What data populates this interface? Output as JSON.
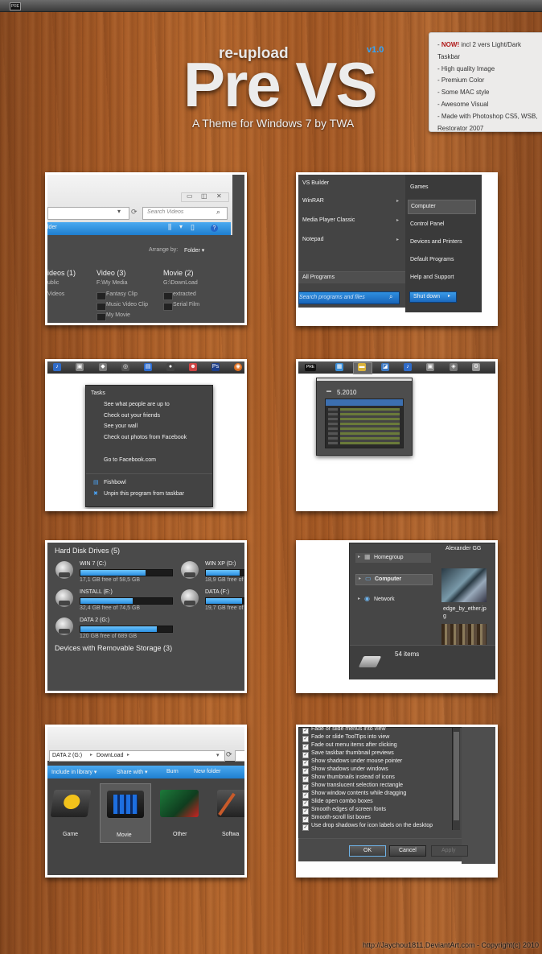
{
  "top": {
    "logo": "PRE"
  },
  "hero": {
    "reupload": "re-upload",
    "title": "Pre VS",
    "version": "v1.0",
    "subtitle": "A Theme for Windows 7 by TWA"
  },
  "features": {
    "new_label": "NOW!",
    "new_rest": " incl 2 vers Light/Dark Taskbar",
    "items": [
      "- High quality Image",
      "- Premium Color",
      "- Some MAC style",
      "- Awesome Visual",
      "- Made with Photoshop CS5, WSB,",
      "  Restorator 2007"
    ]
  },
  "p1": {
    "search_placeholder": "Search Videos",
    "toolbar_left": "lder",
    "arrange_label": "Arrange by:",
    "arrange_value": "Folder",
    "groups": [
      {
        "title": "ideos (1)",
        "sub": "ublic",
        "items": [
          "Videos"
        ]
      },
      {
        "title": "Video (3)",
        "sub": "F:\\My Media",
        "items": [
          "Fantasy Clip",
          "Music Video Clip",
          "My Movie"
        ]
      },
      {
        "title": "Movie (2)",
        "sub": "G:\\DownLoad",
        "items": [
          "extracted",
          "Serial Film"
        ]
      }
    ]
  },
  "p2": {
    "left_items": [
      "VS Builder",
      "WinRAR",
      "Media Player Classic",
      "Notepad"
    ],
    "all_programs": "All Programs",
    "search_placeholder": "Search programs and files",
    "right_items": [
      "Games",
      "Computer",
      "Control Panel",
      "Devices and Printers",
      "Default Programs",
      "Help and Support"
    ],
    "shutdown": "Shut down"
  },
  "p3": {
    "tasks_title": "Tasks",
    "tasks": [
      "See what people are up to",
      "Check out your friends",
      "See your wall",
      "Check out photos from Facebook"
    ],
    "go_to": "Go to Facebook.com",
    "fishbowl": "Fishbowl",
    "unpin": "Unpin this program from taskbar"
  },
  "p4": {
    "preview_title": "5.2010"
  },
  "p5": {
    "hdd_header": "Hard Disk Drives (5)",
    "drives": [
      {
        "name": "WIN 7 (C:)",
        "free": "17,1 GB free of 58,5 GB",
        "used": 0.71
      },
      {
        "name": "INSTALL (E:)",
        "free": "32,4 GB free of 74,5 GB",
        "used": 0.57
      },
      {
        "name": "DATA 2 (G:)",
        "free": "120 GB free of 689 GB",
        "used": 0.83
      },
      {
        "name": "WIN XP (D:)",
        "free": "18,9 GB free of",
        "used": 0.7
      },
      {
        "name": "DATA (F:)",
        "free": "19,7 GB free of",
        "used": 0.75
      }
    ],
    "removable_header": "Devices with Removable Storage (3)"
  },
  "p6": {
    "user": "Alexander GG",
    "nav": [
      "Homegroup",
      "Computer",
      "Network"
    ],
    "file_name": "edge_by_ether.jp\ng",
    "items_count": "54 items"
  },
  "p7": {
    "crumbs": [
      "DATA 2 (G:)",
      "DownLoad"
    ],
    "toolbar": [
      "Include in library",
      "Share with",
      "Burn",
      "New folder"
    ],
    "folders": [
      "Game",
      "Movie",
      "Other",
      "Softwa"
    ]
  },
  "p8": {
    "options": [
      "Fade or slide menus into view",
      "Fade or slide ToolTips into view",
      "Fade out menu items after clicking",
      "Save taskbar thumbnail previews",
      "Show shadows under mouse pointer",
      "Show shadows under windows",
      "Show thumbnails instead of icons",
      "Show translucent selection rectangle",
      "Show window contents while dragging",
      "Slide open combo boxes",
      "Smooth edges of screen fonts",
      "Smooth-scroll list boxes",
      "Use drop shadows for icon labels on the desktop"
    ],
    "ok": "OK",
    "cancel": "Cancel",
    "apply": "Apply"
  },
  "footer": {
    "credit": "http://Jaychou1811.DeviantArt.com - Copyright(c) 2010"
  },
  "colors": {
    "accent": "#2b8fe0",
    "panel_dark": "#3e3e3e",
    "new_red": "#b01818"
  }
}
